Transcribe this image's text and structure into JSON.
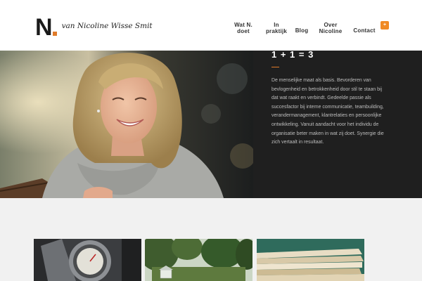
{
  "brand": {
    "logo_letter": "N",
    "tagline": "van Nicoline Wisse Smit",
    "accent_color": "#e07b2a"
  },
  "nav": {
    "items": [
      {
        "line1": "Wat N.",
        "line2": "doet"
      },
      {
        "line1": "In",
        "line2": "praktijk"
      },
      {
        "line1": "Blog",
        "line2": ""
      },
      {
        "line1": "Over",
        "line2": "Nicoline"
      },
      {
        "line1": "Contact",
        "line2": ""
      }
    ],
    "cart_icon": "plus-icon",
    "cart_symbol": "+"
  },
  "hero": {
    "title": "1 + 1 = 3",
    "text": "De menselijke maat als basis. Bevorderen van bevlogenheid en betrokkenheid door stil te staan bij dat wat raakt en verbindt. Gedeelde passie als succesfactor bij interne communicatie, teambuilding, verandermanagement, klantrelaties en persoonlijke ontwikkeling. Vanuit aandacht voor het individu de organisatie beter maken in wat zij doet. Synergie die zich vertaalt in resultaat."
  }
}
